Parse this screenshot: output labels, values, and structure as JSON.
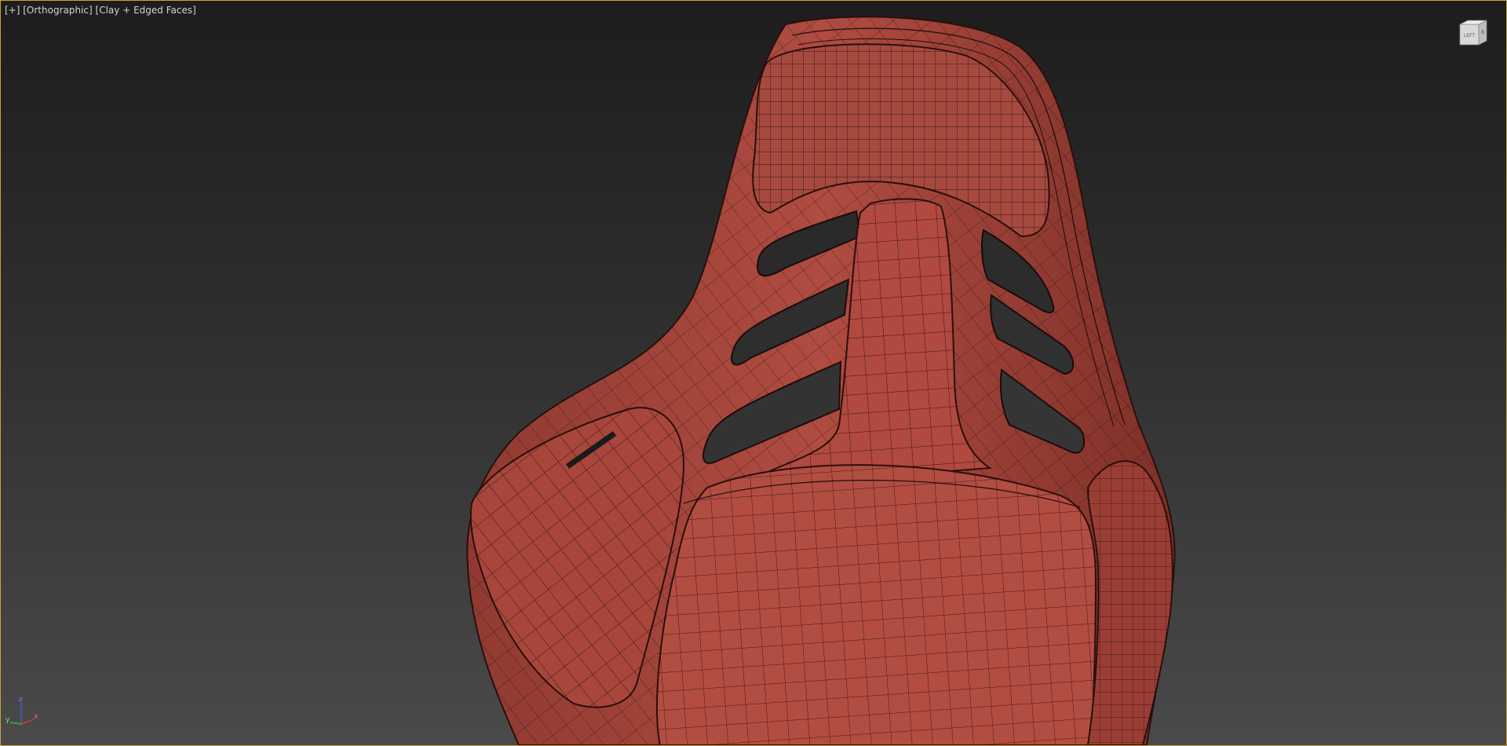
{
  "viewport": {
    "menu_label": "[+]",
    "view_label": "[Orthographic]",
    "shading_label": "[Clay + Edged Faces]"
  },
  "viewcube": {
    "front_face_label": "LEFT",
    "side_face_label": "B"
  },
  "axis_tripod": {
    "x_label": "x",
    "y_label": "y",
    "z_label": "z"
  },
  "colors": {
    "viewport_border": "#c8a23a",
    "background_top": "#1d1d1d",
    "background_bottom": "#4a4a4a",
    "clay": "#a5453c",
    "wire": "#1b0c0a"
  },
  "model": {
    "name": "racing-seat",
    "shading": "clay-edged-faces"
  }
}
